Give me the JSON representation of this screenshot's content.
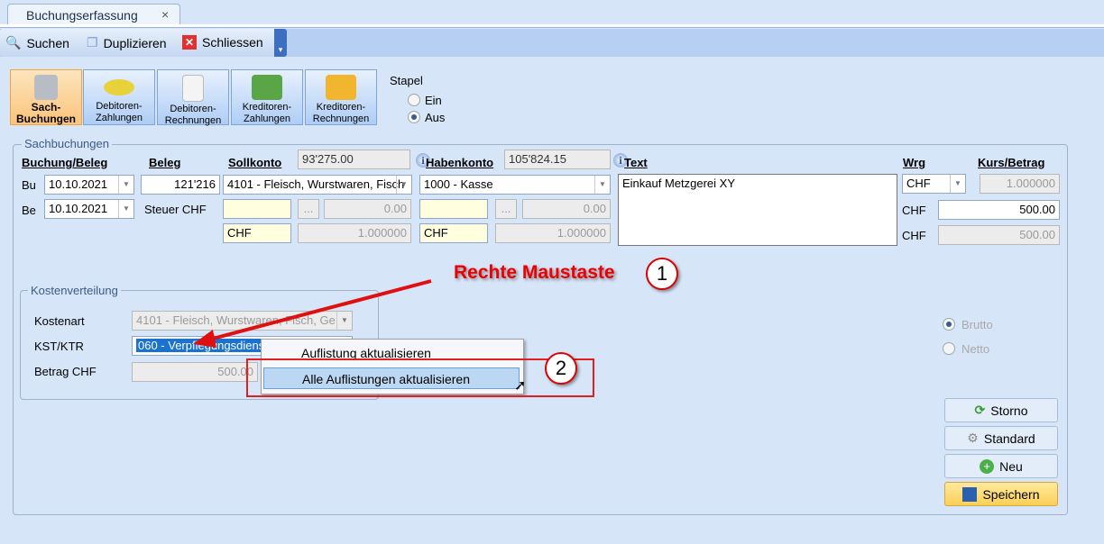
{
  "tab": {
    "title": "Buchungserfassung",
    "close": "×"
  },
  "toolbar": {
    "search": "Suchen",
    "duplicate": "Duplizieren",
    "close": "Schliessen"
  },
  "nav": [
    {
      "l1": "Sach-",
      "l2": "Buchungen"
    },
    {
      "l1": "Debitoren-",
      "l2": "Zahlungen"
    },
    {
      "l1": "Debitoren-",
      "l2": "Rechnungen"
    },
    {
      "l1": "Kreditoren-",
      "l2": "Zahlungen"
    },
    {
      "l1": "Kreditoren-",
      "l2": "Rechnungen"
    }
  ],
  "stapel": {
    "label": "Stapel",
    "ein": "Ein",
    "aus": "Aus",
    "selected": "Aus"
  },
  "sach": {
    "title": "Sachbuchungen",
    "h_buchung": "Buchung/Beleg",
    "h_beleg": "Beleg",
    "h_soll": "Sollkonto",
    "soll_saldo": "93'275.00",
    "h_haben": "Habenkonto",
    "haben_saldo": "105'824.15",
    "h_text": "Text",
    "h_wrg": "Wrg",
    "h_kurs": "Kurs/Betrag",
    "bu_label": "Bu",
    "bu_date": "10.10.2021",
    "be_label": "Be",
    "be_date": "10.10.2021",
    "beleg_nr": "121'216",
    "steuer": "Steuer CHF",
    "soll_konto": "4101 - Fleisch, Wurstwaren, Fisch",
    "soll_tax": "0.00",
    "soll_cur": "CHF",
    "soll_rate": "1.000000",
    "more": "...",
    "haben_konto": "1000 - Kasse",
    "haben_tax": "0.00",
    "haben_cur": "CHF",
    "haben_rate": "1.000000",
    "text": "Einkauf Metzgerei XY",
    "wrg": "CHF",
    "kurs": "1.000000",
    "cur2": "CHF",
    "betrag": "500.00",
    "cur3": "CHF",
    "betrag2": "500.00"
  },
  "kosten": {
    "title": "Kostenverteilung",
    "kostenart_label": "Kostenart",
    "kostenart": "4101 - Fleisch, Wurstwaren, Fisch, Ge",
    "kst_label": "KST/KTR",
    "kst": "060 - Verpflegungsdienst",
    "betrag_label": "Betrag CHF",
    "betrag": "500.00"
  },
  "brutto": "Brutto",
  "netto": "Netto",
  "buttons": {
    "storno": "Storno",
    "standard": "Standard",
    "neu": "Neu",
    "speichern": "Speichern"
  },
  "context_menu": [
    "Auflistung aktualisieren",
    "Alle Auflistungen aktualisieren"
  ],
  "annotation": {
    "text": "Rechte Maustaste",
    "step1": "1",
    "step2": "2"
  }
}
